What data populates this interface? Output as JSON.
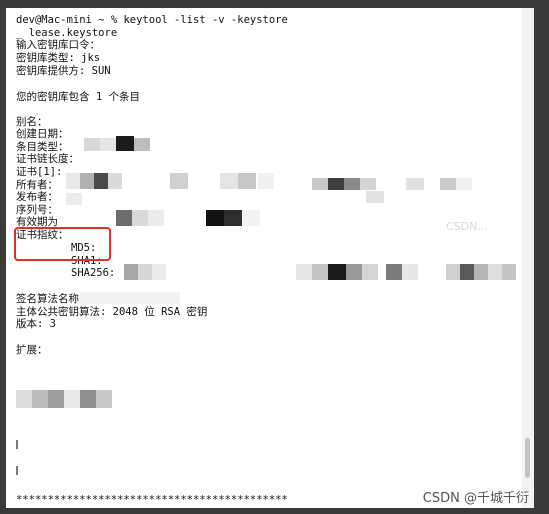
{
  "terminal": {
    "lines": {
      "prompt": "dev@Mac-mini ~ % keytool -list -v -keystore",
      "keystore_file": "_ lease.keystore",
      "enter_password": "输入密钥库口令：",
      "keystore_type": "密钥库类型: jks",
      "keystore_provider": "密钥库提供方: SUN",
      "contains": "您的密钥库包含 1 个条目",
      "alias": "别名：",
      "created": "创建日期：",
      "entry_type": "条目类型：",
      "chain_length": "证书链长度：",
      "cert_index": "证书[1]:",
      "owner": "所有者：",
      "issuer": "发布者：",
      "serial": "序列号：",
      "validity": "有效期为",
      "fingerprints": "证书指纹：",
      "md5": "MD5:",
      "sha1": "SHA1:",
      "sha256": "SHA256:",
      "sig_algo": "签名算法名称：",
      "pubkey": "主体公共密钥算法: 2048 位 RSA 密钥",
      "version": "版本: 3",
      "extensions": "扩展：",
      "stars": "*******************************************"
    }
  },
  "watermark": "CSDN @千城千衍",
  "ghost_text": "CSDN..."
}
